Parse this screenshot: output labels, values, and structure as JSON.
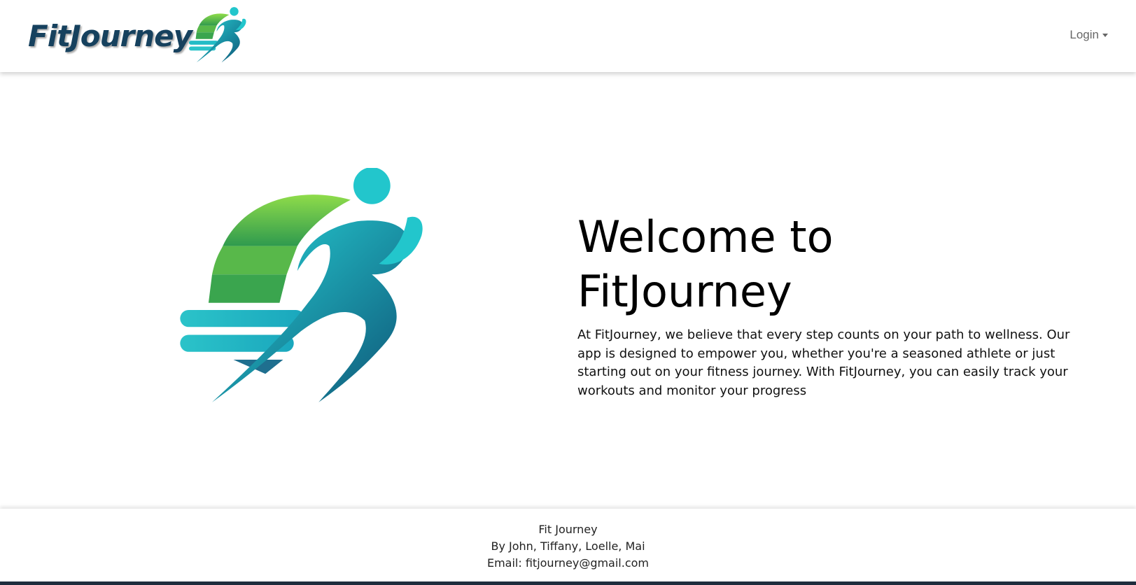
{
  "nav": {
    "brand": "FitJourney",
    "login_label": "Login"
  },
  "hero": {
    "title_line1": "Welcome to",
    "title_line2": "FitJourney",
    "body": "At FitJourney, we believe that every step counts on your path to wellness. Our app is designed to empower you, whether you're a seasoned athlete or just starting out on your fitness journey. With FitJourney, you can easily track your workouts and monitor your progress"
  },
  "footer": {
    "name": "Fit Journey",
    "authors": "By John, Tiffany, Loelle, Mai",
    "email": "Email: fitjourney@gmail.com"
  },
  "colors": {
    "brand_text": "#16415e",
    "logo_green": "#5cc94a",
    "logo_teal": "#1bbfc9",
    "logo_dark": "#0f4e73"
  },
  "icons": {
    "brand_mark": "runner-logo-icon",
    "hero_logo": "runner-logo-icon",
    "login_caret": "caret-down-icon"
  }
}
